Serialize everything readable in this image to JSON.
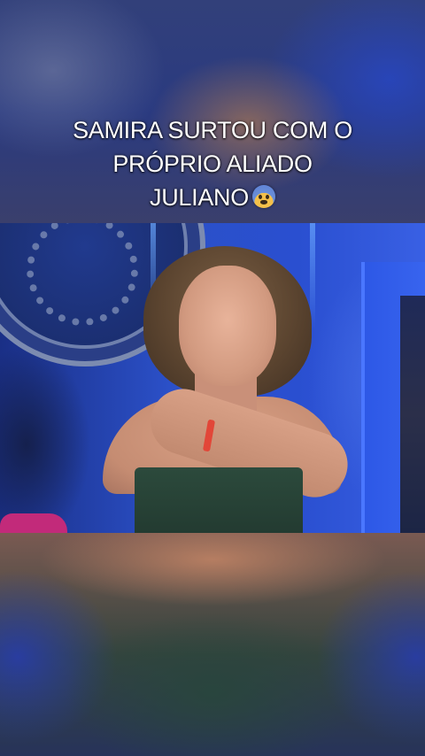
{
  "caption": {
    "line1": "SAMIRA SURTOU COM O",
    "line2": "PRÓPRIO ALIADO",
    "line3": "JULIANO",
    "emoji_icon": "fearful-face-emoji"
  },
  "colors": {
    "caption_text": "#ffffff",
    "studio_blue": "#2346b8"
  }
}
